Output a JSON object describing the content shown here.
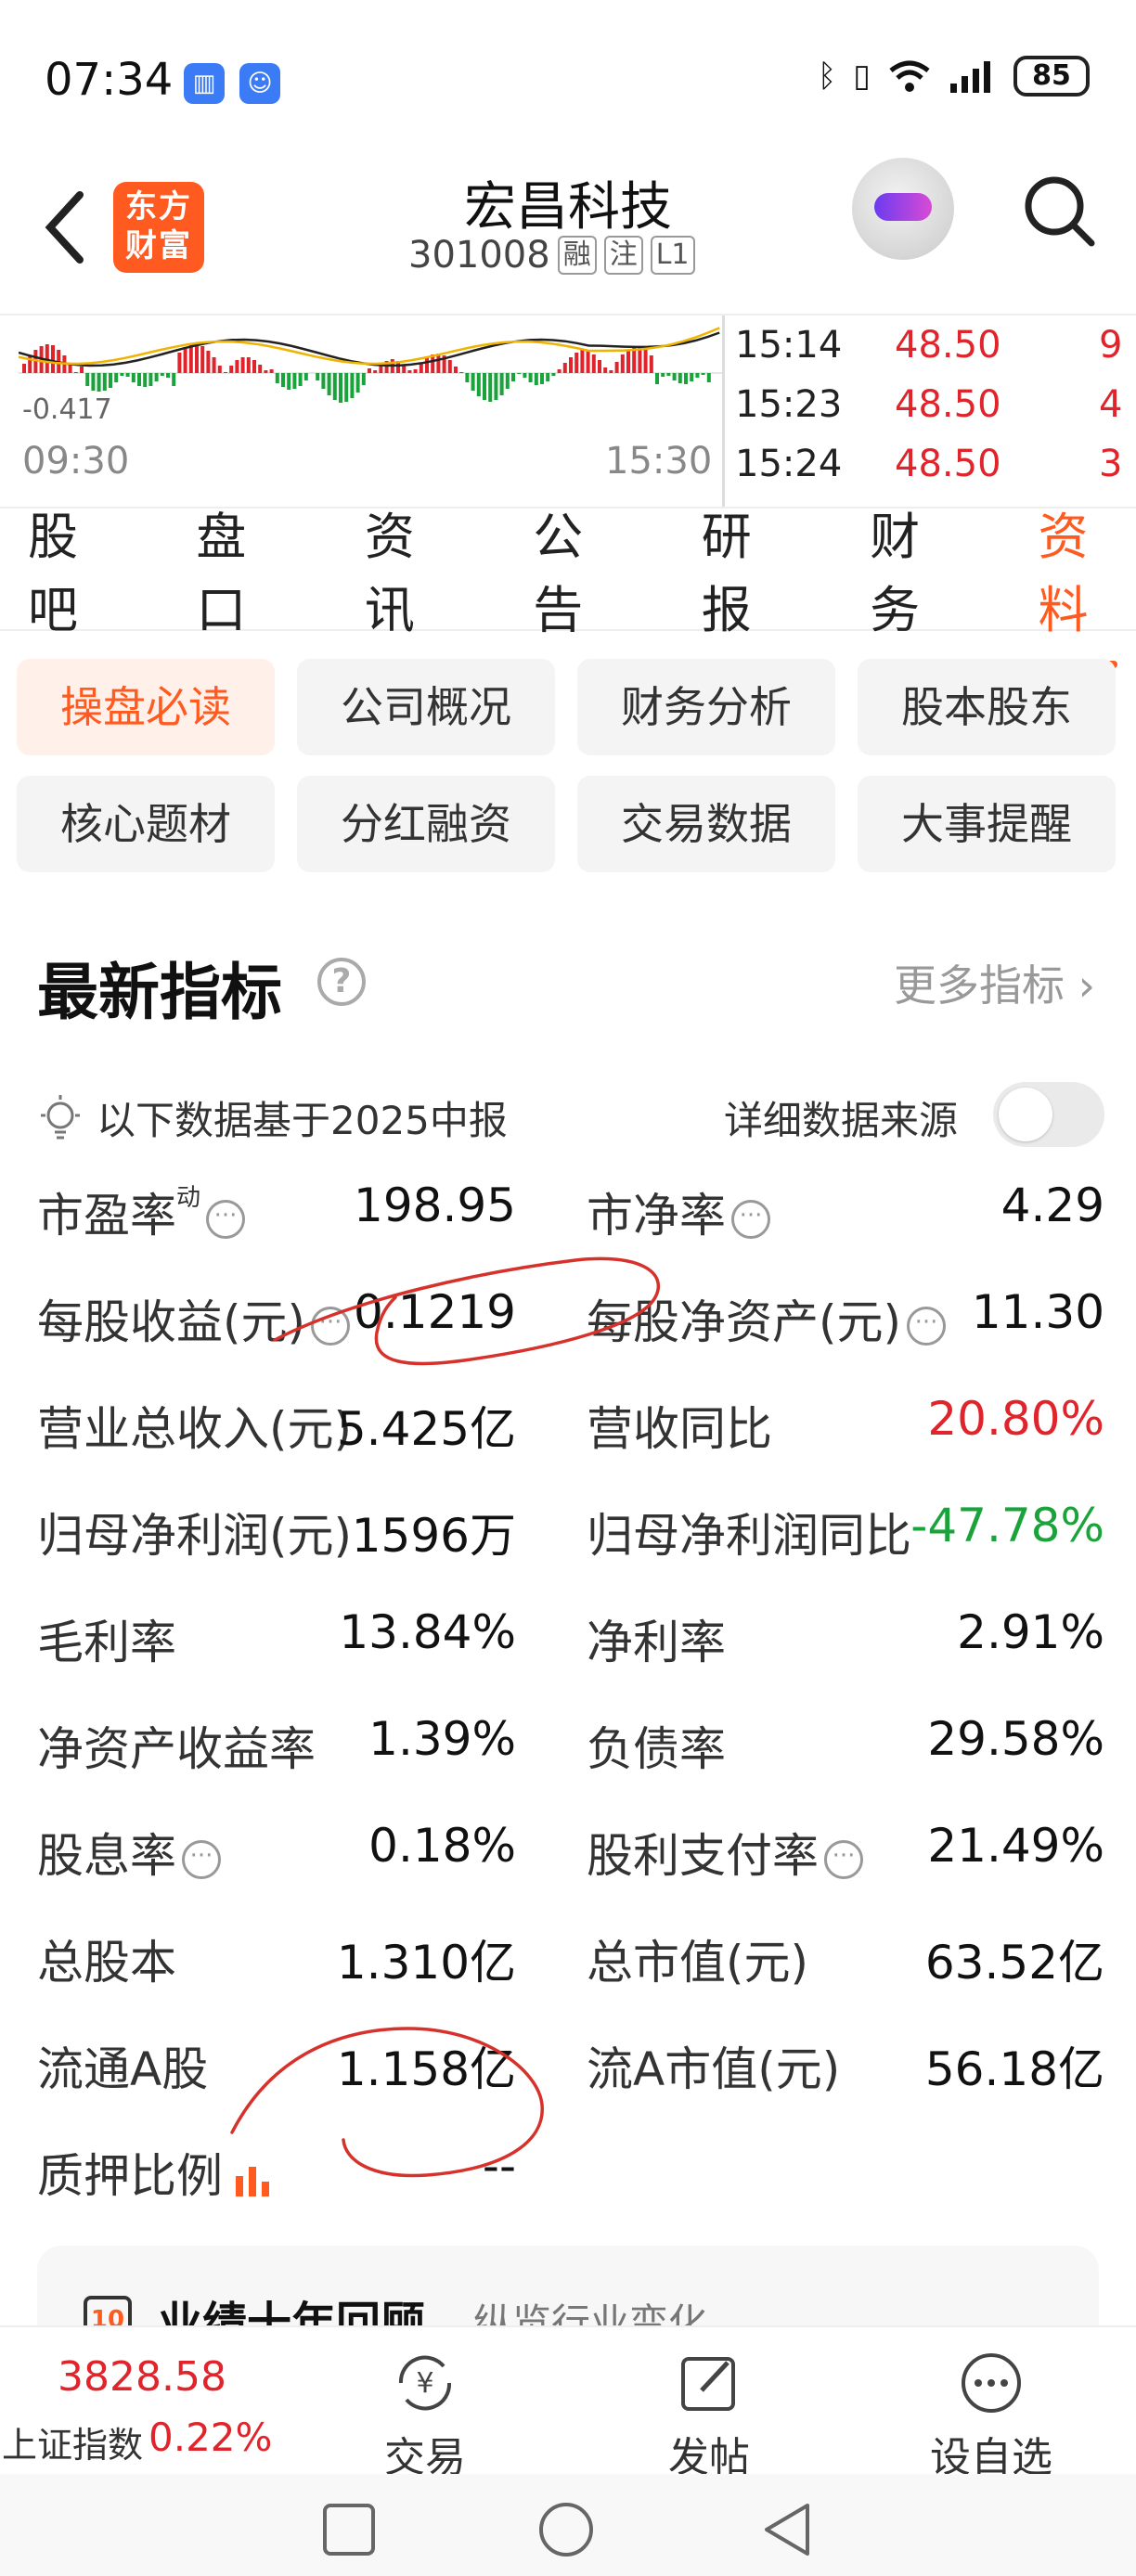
{
  "status_bar": {
    "time": "07:34",
    "battery": "85",
    "icons": [
      "voice-app-icon",
      "contact-app-icon",
      "bluetooth-icon",
      "vibrate-icon",
      "wifi-icon",
      "signal-icon"
    ]
  },
  "header": {
    "brand_logo": "东方\n财富",
    "stock_name": "宏昌科技",
    "stock_code": "301008",
    "tags": [
      "融",
      "注",
      "L1"
    ]
  },
  "chart": {
    "low_label": "-0.417",
    "start_time": "09:30",
    "end_time": "15:30",
    "ticks": [
      {
        "time": "15:14",
        "price": "48.50",
        "vol": "9"
      },
      {
        "time": "15:23",
        "price": "48.50",
        "vol": "4"
      },
      {
        "time": "15:24",
        "price": "48.50",
        "vol": "3"
      }
    ]
  },
  "tabs": [
    "股吧",
    "盘口",
    "资讯",
    "公告",
    "研报",
    "财务",
    "资料"
  ],
  "active_tab": "资料",
  "grid_buttons": [
    "操盘必读",
    "公司概况",
    "财务分析",
    "股本股东",
    "核心题材",
    "分红融资",
    "交易数据",
    "大事提醒"
  ],
  "section": {
    "title": "最新指标",
    "more": "更多指标 ›",
    "info": "以下数据基于2025中报",
    "source": "详细数据来源"
  },
  "metrics": [
    {
      "l_label": "市盈率",
      "l_sup": "动",
      "l_value": "198.95",
      "r_label": "市净率",
      "r_value": "4.29"
    },
    {
      "l_label": "每股收益(元)",
      "l_value": "0.1219",
      "r_label": "每股净资产(元)",
      "r_value": "11.30"
    },
    {
      "l_label": "营业总收入(元)",
      "l_value": "5.425亿",
      "r_label": "营收同比",
      "r_value": "20.80%"
    },
    {
      "l_label": "归母净利润(元)",
      "l_value": "1596万",
      "r_label": "归母净利润同比",
      "r_value": "-47.78%"
    },
    {
      "l_label": "毛利率",
      "l_value": "13.84%",
      "r_label": "净利率",
      "r_value": "2.91%"
    },
    {
      "l_label": "净资产收益率",
      "l_value": "1.39%",
      "r_label": "负债率",
      "r_value": "29.58%"
    },
    {
      "l_label": "股息率",
      "l_value": "0.18%",
      "r_label": "股利支付率",
      "r_value": "21.49%"
    },
    {
      "l_label": "总股本",
      "l_value": "1.310亿",
      "r_label": "总市值(元)",
      "r_value": "63.52亿"
    },
    {
      "l_label": "流通A股",
      "l_value": "1.158亿",
      "r_label": "流A市值(元)",
      "r_value": "56.18亿"
    },
    {
      "l_label": "质押比例",
      "l_value": "--"
    }
  ],
  "teaser": {
    "icon": "10",
    "title": "业绩十年回顾",
    "subtitle": "纵览行业变化"
  },
  "bottom": {
    "index_value": "3828.58",
    "index_name": "上证指数",
    "index_change": "0.22%",
    "actions": [
      "交易",
      "发帖",
      "设自选"
    ]
  },
  "colors": {
    "accent": "#ff5a1f",
    "up": "#e0242b",
    "down": "#1aa33a"
  }
}
